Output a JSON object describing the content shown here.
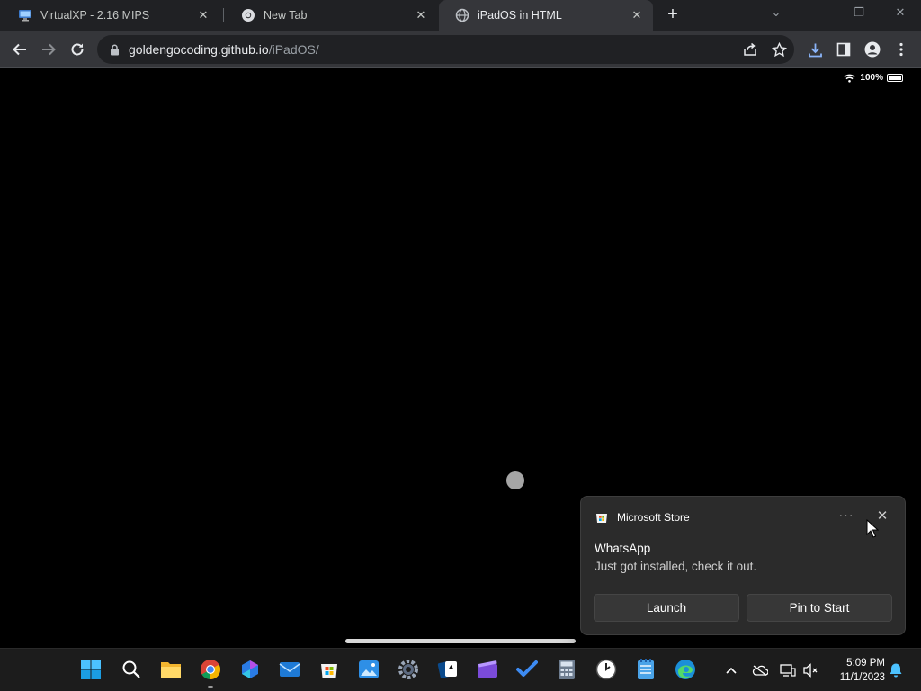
{
  "browser": {
    "tabs": [
      {
        "title": "VirtualXP - 2.16 MIPS",
        "icon": "monitor-icon",
        "active": false
      },
      {
        "title": "New Tab",
        "icon": "chrome-icon",
        "active": false
      },
      {
        "title": "iPadOS in HTML",
        "icon": "globe-icon",
        "active": true
      }
    ],
    "close_glyph": "✕",
    "new_tab_glyph": "+",
    "window_controls": [
      "⌄",
      "—",
      "❐",
      "✕"
    ],
    "url_host": "goldengocoding.github.io",
    "url_path": "/iPadOS/"
  },
  "ipad": {
    "battery_percent": "100%",
    "battery_level": 1.0
  },
  "toast": {
    "app_name": "Microsoft Store",
    "more_glyph": "···",
    "close_glyph": "✕",
    "heading": "WhatsApp",
    "body": "Just got installed, check it out.",
    "launch_label": "Launch",
    "pin_label": "Pin to Start"
  },
  "taskbar": {
    "apps": [
      "start-icon",
      "search-icon",
      "file-explorer-icon",
      "chrome-icon",
      "copilot-icon",
      "mail-icon",
      "microsoft-store-icon",
      "photos-icon",
      "settings-icon",
      "solitaire-icon",
      "clipchamp-icon",
      "todo-icon",
      "calculator-icon",
      "clock-icon",
      "notepad-icon",
      "edge-icon"
    ],
    "time": "5:09 PM",
    "date": "11/1/2023"
  },
  "colors": {
    "chrome_dark": "#202124",
    "chrome_toolbar": "#35363a",
    "taskbar": "#1c1c1c",
    "toast_bg": "#2b2b2b",
    "accent_blue": "#0078d4"
  }
}
